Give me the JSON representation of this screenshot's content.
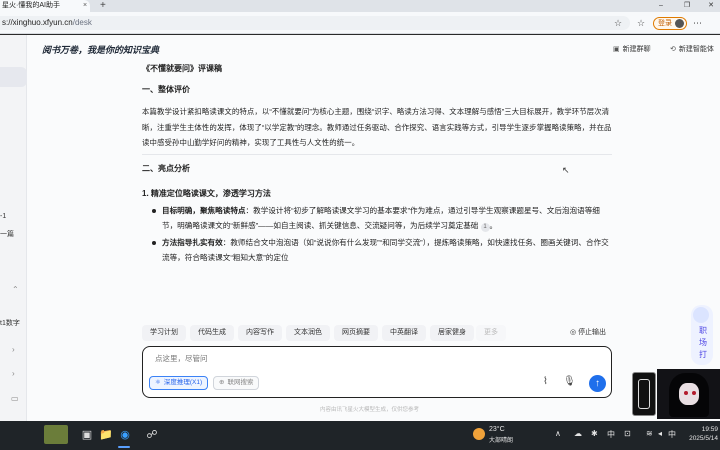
{
  "browser": {
    "tab_title": "星火·懂我的AI助手",
    "tab_close": "×",
    "new_tab": "+",
    "win_min": "–",
    "win_max": "❐",
    "win_close": "✕",
    "url_host": "s://xinghuo.xfyun.cn",
    "url_path": "/desk",
    "login_label": "登录"
  },
  "sidebar": {
    "fragments": [
      "-1",
      "一篇",
      "t1数字"
    ]
  },
  "header": {
    "title": "阅书万卷，我是你的知识宝典",
    "new_group": "新建群聊",
    "new_agent": "新建智能体"
  },
  "doc": {
    "title": "《不懂就要问》评课稿",
    "section1": "一、整体评价",
    "para1": "本篇教学设计紧扣略读课文的特点，以“不懂就要问”为核心主题，围绕“识字、略读方法习得、文本理解与感悟”三大目标展开，教学环节层次清晰，注重学生主体性的发挥，体现了“以学定教”的理念。教师通过任务驱动、合作探究、语言实践等方式，引导学生逐步掌握略读策略，并在品读中感受孙中山勤学好问的精神，实现了工具性与人文性的统一。",
    "section2": "二、亮点分析",
    "sub1": "1. 精准定位略读课文，渗透学习方法",
    "b1_head": "目标明确，聚焦略读特点",
    "b1_text": "：教学设计将“初步了解略读课文学习的基本要求”作为难点，通过引导学生观察课题星号、文后泡泡语等细节，明确略读课文的“新鲜感”——如自主阅读、抓关键信息、交流疑问等，为后续学习奠定基础",
    "b1_cite": "1",
    "b1_end": "。",
    "b2_head": "方法指导扎实有效",
    "b2_text": "：教师结合文中泡泡语（如“说说你有什么发现”“和同学交流”），提炼略读策略，如快速找任务、圈画关键词、合作交流等，符合略读课文“粗知大意”的定位"
  },
  "chips": [
    "学习计划",
    "代码生成",
    "内容写作",
    "文本润色",
    "网页摘要",
    "中英翻译",
    "居家健身",
    "更多"
  ],
  "stop_label": "停止输出",
  "input": {
    "placeholder": "点这里，尽管问",
    "deep_reasoning": "深度推理(X1)",
    "web_search": "联网搜索"
  },
  "footer_note": "内容由讯飞星火大模型生成，仅供您参考",
  "mascot_text": "职场打",
  "taskbar": {
    "weather_temp": "23°C",
    "weather_desc": "大部晴朗",
    "ime": "中",
    "ime2": "中",
    "time": "19:59",
    "date": "2025/5/14"
  },
  "colors": {
    "accent": "#1f6feb",
    "login": "#e07b00"
  }
}
